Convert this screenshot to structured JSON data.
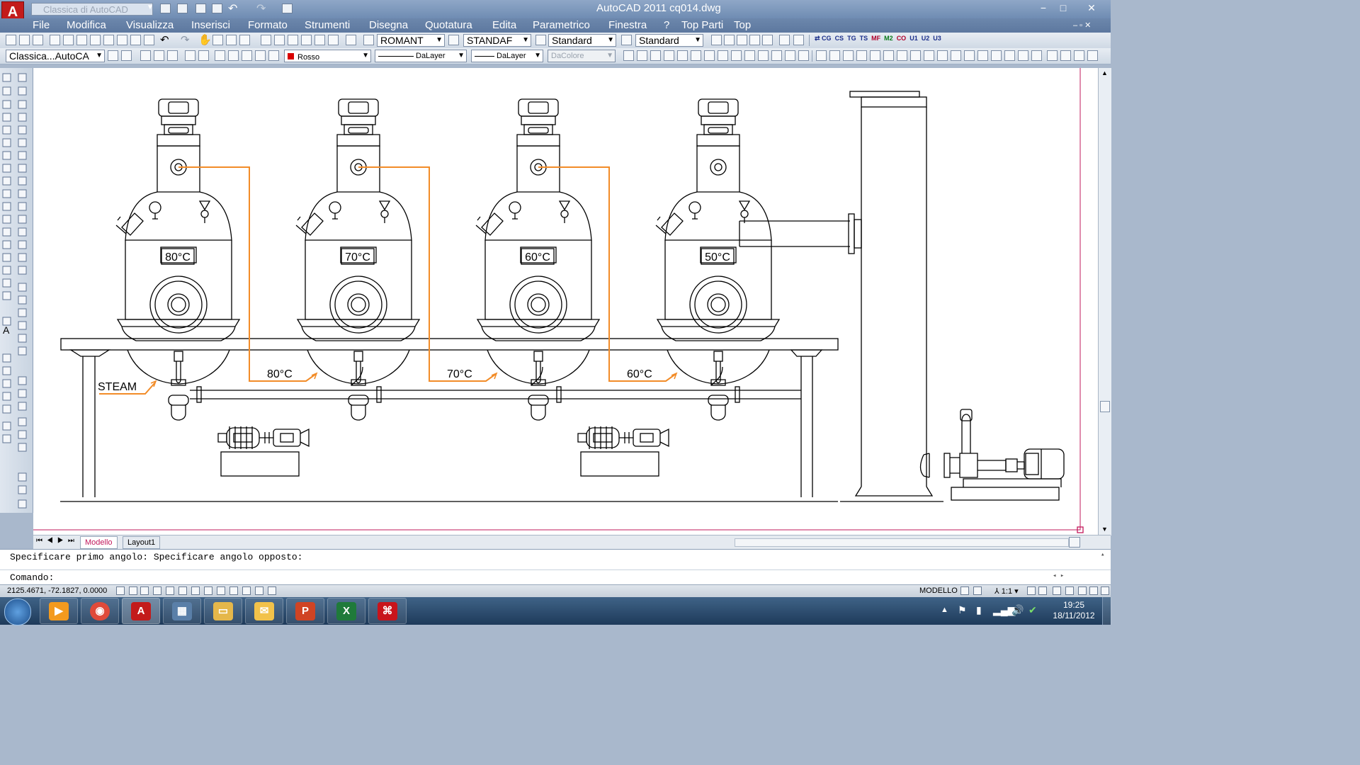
{
  "window": {
    "title": "AutoCAD 2011    cq014.dwg",
    "workspace": "Classica di AutoCAD",
    "controls": [
      "−",
      "□",
      "✕"
    ]
  },
  "menubar": [
    "File",
    "Modifica",
    "Visualizza",
    "Inserisci",
    "Formato",
    "Strumenti",
    "Disegna",
    "Quotatura",
    "Edita",
    "Parametrico",
    "Finestra",
    "?",
    "Top Parti",
    "Top"
  ],
  "toolbar1": {
    "text_style": "ROMANT",
    "dim_style": "STANDAF",
    "table_style": "Standard",
    "mleader_style": "Standard",
    "command_strip": [
      "CG",
      "CS",
      "TG",
      "TS",
      "MF",
      "M2",
      "CO",
      "U1",
      "U2",
      "U3"
    ]
  },
  "toolbar2": {
    "workspace": "Classica...AutoCA",
    "color": "Rosso",
    "color_hex": "#d80000",
    "linetype": "DaLayer",
    "lineweight": "DaLayer",
    "plotstyle": "DaColore"
  },
  "drawing": {
    "vessel_temps": [
      "80°C",
      "70°C",
      "60°C",
      "50°C"
    ],
    "flow_labels": [
      "80°C",
      "70°C",
      "60°C"
    ],
    "steam_label": "STEAM",
    "pipe_color": "#f28c28"
  },
  "tabs": [
    "Modello",
    "Layout1"
  ],
  "command": {
    "history": "Specificare primo angolo: Specificare angolo opposto:",
    "prompt": "Comando:"
  },
  "status": {
    "coords": "2125.4671, -72.1827, 0.0000",
    "space": "MODELLO",
    "scale": "1:1"
  },
  "taskbar": {
    "time": "19:25",
    "date": "18/11/2012",
    "apps": [
      "media-player",
      "chrome",
      "autocad",
      "calculator",
      "explorer",
      "outlook",
      "powerpoint",
      "excel",
      "acrobat"
    ]
  }
}
